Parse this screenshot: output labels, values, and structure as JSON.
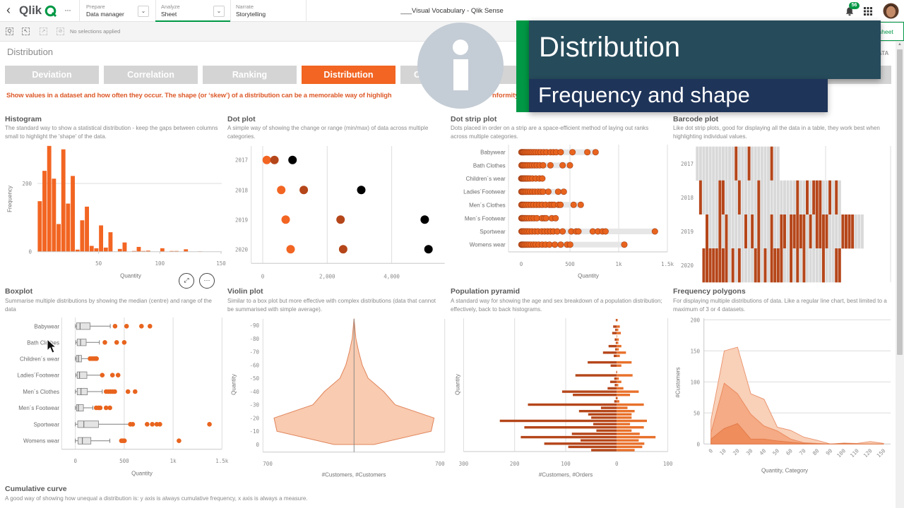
{
  "app": {
    "logo_text": "Qlik",
    "nav": [
      {
        "caption": "Prepare",
        "label": "Data manager"
      },
      {
        "caption": "Analyze",
        "label": "Sheet",
        "active": true
      },
      {
        "caption": "Narrate",
        "label": "Storytelling"
      }
    ],
    "more_glyph": "···",
    "back_glyph": "‹",
    "dropdown_glyph": "⌄",
    "title": "___Visual Vocabulary - Qlik Sense",
    "notifications_count": "56",
    "icons": [
      "chevron-left-icon",
      "qlik-logo-icon",
      "ellipsis-icon",
      "bell-icon",
      "app-grid-icon",
      "avatar"
    ]
  },
  "toolbar": {
    "selections_text": "No selections applied",
    "icons": [
      "smart-search-icon",
      "selections-tool-icon",
      "step-forward-icon",
      "clear-selections-icon"
    ]
  },
  "sheet": {
    "title": "Distribution",
    "tabs": [
      {
        "label": "Deviation"
      },
      {
        "label": "Correlation"
      },
      {
        "label": "Ranking"
      },
      {
        "label": "Distribution",
        "active": true
      },
      {
        "label": "C"
      }
    ],
    "intro_text": "Show values in a dataset and how often they occur. The shape (or ‘skew’) of a distribution can be a memorable way of highligh",
    "intro_tail": "nformity",
    "edit_button": "Edit sheet",
    "right_link_fragment": "ATA",
    "next_section": {
      "title": "Cumulative curve",
      "description": "A good way of showing how unequal a distribution is: y axis is always cumulative frequency, x axis is always a measure."
    },
    "chart_actions": {
      "expand_glyph": "⤢",
      "more_glyph": "···"
    }
  },
  "overlay": {
    "info_glyph": "i",
    "heading": "Distribution",
    "subheading": "Frequency and shape"
  },
  "theme": {
    "accent": "#f26522",
    "dark_orange": "#b5461a",
    "tab_inactive": "#d4d4d4",
    "qlik_green": "#009845",
    "overlay_teal": "#264b5b",
    "overlay_navy": "#1f3459"
  },
  "chart_data": [
    {
      "id": "histogram",
      "type": "bar",
      "title": "Histogram",
      "description": "The standard way to show a statistical distribution - keep the gaps between columns small to highlight the 'shape' of the data.",
      "xlabel": "Quantity",
      "ylabel": "Frequency",
      "xlim": [
        0,
        150
      ],
      "x_ticks": [
        50,
        100,
        150
      ],
      "y_ticks": [
        0,
        200
      ],
      "bin_width": 3.85,
      "values": [
        148,
        237,
        310,
        214,
        81,
        300,
        141,
        222,
        6,
        92,
        132,
        17,
        10,
        77,
        12,
        57,
        0,
        8,
        27,
        0,
        2,
        14,
        2,
        3,
        0,
        0,
        10,
        0,
        2,
        2,
        0,
        7,
        0,
        0,
        1,
        0,
        0,
        0,
        0
      ],
      "color": "#f26522",
      "grid": true
    },
    {
      "id": "dot-plot",
      "type": "scatter",
      "title": "Dot plot",
      "description": "A simple way of showing the change or range (min/max) of data across multiple categories.",
      "categories": [
        "2017",
        "2018",
        "2019",
        "2020"
      ],
      "series": [
        {
          "color": "#f26522",
          "values": [
            124,
            575,
            713,
            866
          ]
        },
        {
          "color": "#b5461a",
          "values": [
            364,
            1273,
            2415,
            2495
          ]
        },
        {
          "color": "#000000",
          "values": [
            924,
            3055,
            5025,
            5142
          ]
        }
      ],
      "x_ticks": [
        0,
        2000,
        4000
      ],
      "x_tick_labels": [
        "0",
        "2,000",
        "4,000"
      ],
      "xlim": [
        -350,
        5630
      ]
    },
    {
      "id": "dot-strip-plot",
      "type": "scatter",
      "title": "Dot strip plot",
      "description": "Dots placed in order on a strip are a space-efficient method of laying out ranks across multiple categories.",
      "xlabel": "Quantity",
      "categories": [
        "Babywear",
        "Bath Clothes",
        "Children´s wear",
        "Ladies´Footwear",
        "Men´s Clothes",
        "Men´s Footwear",
        "Sportwear",
        "Womens wear"
      ],
      "values": [
        [
          2,
          8,
          15,
          22,
          30,
          40,
          52,
          65,
          80,
          95,
          110,
          130,
          150,
          175,
          200,
          230,
          260,
          300,
          330,
          360,
          405,
          526,
          678,
          763
        ],
        [
          3,
          10,
          18,
          28,
          40,
          55,
          70,
          90,
          110,
          135,
          160,
          190,
          225,
          300,
          425,
          500
        ],
        [
          1,
          5,
          10,
          16,
          24,
          32,
          42,
          55,
          70,
          90,
          115,
          150,
          188,
          217
        ],
        [
          2,
          8,
          15,
          25,
          38,
          52,
          70,
          90,
          115,
          140,
          170,
          200,
          225,
          278,
          379,
          437
        ],
        [
          2,
          8,
          15,
          25,
          38,
          55,
          75,
          100,
          125,
          155,
          185,
          215,
          250,
          290,
          314,
          338,
          382,
          403,
          538,
          611
        ],
        [
          2,
          7,
          14,
          22,
          32,
          45,
          60,
          80,
          105,
          130,
          160,
          213,
          237,
          254,
          314,
          353
        ],
        [
          3,
          10,
          20,
          32,
          48,
          65,
          85,
          110,
          140,
          170,
          210,
          240,
          270,
          300,
          330,
          370,
          425,
          514,
          563,
          587,
          734,
          787,
          833,
          865,
          1372
        ],
        [
          2,
          8,
          15,
          24,
          35,
          48,
          62,
          80,
          100,
          125,
          150,
          180,
          215,
          250,
          290,
          345,
          405,
          471,
          502,
          1058
        ]
      ],
      "x_ticks": [
        0,
        500,
        1000,
        1500
      ],
      "x_tick_labels": [
        "0",
        "500",
        "1k",
        "1.5k"
      ],
      "color": "#e8641e"
    },
    {
      "id": "barcode-plot",
      "type": "heatmap",
      "subtype": "barcode",
      "title": "Barcode plot",
      "description": "Like dot strip plots, good for displaying all the data in a table, they work best when highlighting individual values.",
      "categories": [
        "2017",
        "2018",
        "2019",
        "2020"
      ],
      "rows": [
        {
          "extent": [
            0,
            26
          ],
          "marks": [
            12,
            16,
            23
          ]
        },
        {
          "extent": [
            1,
            45
          ],
          "marks": [
            1,
            7,
            8,
            13,
            19,
            31,
            34,
            36,
            37,
            38,
            41,
            43
          ]
        },
        {
          "extent": [
            3,
            52
          ],
          "marks": [
            3,
            7,
            9,
            15,
            17,
            19,
            23,
            26,
            27,
            29,
            30,
            31,
            32,
            33,
            35,
            37,
            38,
            39,
            40,
            45,
            46,
            47,
            48
          ]
        },
        {
          "extent": [
            2,
            45
          ],
          "marks": [
            2,
            3,
            4,
            5,
            6,
            7,
            8,
            9,
            11,
            13,
            18,
            19,
            21,
            23,
            24,
            25,
            26,
            29,
            31,
            33,
            39,
            43,
            44
          ]
        }
      ],
      "mark_color": "#b5461a",
      "base_color": "#d9d9d9"
    },
    {
      "id": "boxplot",
      "type": "bar",
      "subtype": "boxplot",
      "title": "Boxplot",
      "description": "Summarise multiple distributions by showing the median (centre) and range of the data",
      "xlabel": "Quantity",
      "x_ticks": [
        0,
        500,
        1000,
        1500
      ],
      "x_tick_labels": [
        "0",
        "500",
        "1k",
        "1.5k"
      ],
      "boxes": [
        {
          "category": "Babywear",
          "min": 0,
          "q1": 12,
          "median": 48,
          "q3": 150,
          "max": 357,
          "outliers": [
            406,
            524,
            676,
            763
          ]
        },
        {
          "category": "Bath Clothes",
          "min": 5,
          "q1": 19,
          "median": 53,
          "q3": 111,
          "max": 246,
          "outliers": [
            302,
            423,
            500
          ]
        },
        {
          "category": "Children´s wear",
          "min": 0,
          "q1": 10,
          "median": 31,
          "q3": 63,
          "max": 140,
          "outliers": [
            150,
            170,
            188,
            205,
            217
          ]
        },
        {
          "category": "Ladies´Footwear",
          "min": 5,
          "q1": 19,
          "median": 43,
          "q3": 118,
          "max": 275,
          "outliers": [
            275,
            379,
            437
          ]
        },
        {
          "category": "Men´s Clothes",
          "min": 0,
          "q1": 19,
          "median": 58,
          "q3": 123,
          "max": 275,
          "outliers": [
            314,
            338,
            360,
            382,
            403,
            538,
            611
          ]
        },
        {
          "category": "Men´s Footwear",
          "min": 0,
          "q1": 12,
          "median": 31,
          "q3": 82,
          "max": 179,
          "outliers": [
            213,
            237,
            254,
            314,
            353
          ]
        },
        {
          "category": "Sportwear",
          "min": 0,
          "q1": 24,
          "median": 87,
          "q3": 237,
          "max": 563,
          "outliers": [
            563,
            587,
            734,
            787,
            833,
            865,
            1372
          ]
        },
        {
          "category": "Womens wear",
          "min": 0,
          "q1": 27,
          "median": 72,
          "q3": 159,
          "max": 353,
          "outliers": [
            471,
            487,
            502,
            1060
          ]
        }
      ],
      "outlier_color": "#e8641e"
    },
    {
      "id": "violin-plot",
      "type": "area",
      "subtype": "violin",
      "title": "Violin plot",
      "description": "Similar to a box plot but more effective with complex distributions (data that cannot be summarised with simple average).",
      "ylabel": "Quantity",
      "xlabel": "#Customers, #Customers",
      "x_tick_labels": [
        "700",
        "700"
      ],
      "y_ticks": [
        -90,
        -80,
        -70,
        -60,
        -50,
        -40,
        -30,
        -20,
        -10,
        0
      ],
      "levels": [
        0,
        -10,
        -20,
        -30,
        -40,
        -50,
        -60,
        -70,
        -80,
        -90,
        -95
      ],
      "half_widths": [
        154,
        594,
        616,
        317,
        228,
        109,
        63,
        36,
        14,
        5,
        0
      ],
      "xlim": [
        -700,
        700
      ],
      "fill": "#f9cbb0",
      "stroke": "#e0845a"
    },
    {
      "id": "population-pyramid",
      "type": "bar",
      "subtype": "population-pyramid",
      "title": "Population pyramid",
      "description": "A standard way for showing the age and sex breakdown of a population distribution; effectively, back to back histograms.",
      "ylabel": "Quantity",
      "xlabel": "#Customers, #Orders",
      "x_ticks": [
        -300,
        -200,
        -100,
        0,
        100
      ],
      "x_tick_labels": [
        "300",
        "200",
        "100",
        "0",
        "100"
      ],
      "series": [
        {
          "name": "#Customers",
          "side": "left",
          "color": "#b5461a",
          "values": [
            2,
            0,
            7,
            3,
            9,
            0,
            4,
            2,
            16,
            3,
            27,
            6,
            0,
            57,
            12,
            0,
            1,
            81,
            5,
            13,
            4,
            18,
            107,
            86,
            2,
            5,
            174,
            31,
            74,
            56,
            50,
            229,
            46,
            181,
            40,
            88,
            188,
            71,
            142,
            95,
            50
          ]
        },
        {
          "name": "#Orders",
          "side": "right",
          "color": "#e8702a",
          "values": [
            2,
            0,
            6,
            3,
            8,
            1,
            4,
            3,
            9,
            4,
            18,
            6,
            0,
            29,
            9,
            0,
            1,
            31,
            4,
            9,
            3,
            13,
            43,
            26,
            2,
            5,
            53,
            21,
            35,
            29,
            29,
            59,
            26,
            53,
            29,
            45,
            76,
            43,
            54,
            50,
            35
          ]
        }
      ]
    },
    {
      "id": "frequency-polygons",
      "type": "area",
      "title": "Frequency polygons",
      "description": "For displaying multiple distributions of data. Like a regular line chart, best limited to a maximum of 3 or 4 datasets.",
      "ylabel": "#Customers",
      "xlabel": "Quantity, Category",
      "categories": [
        "0",
        "10",
        "20",
        "30",
        "40",
        "50",
        "60",
        "70",
        "80",
        "90",
        "100",
        "110",
        "120",
        "150"
      ],
      "y_ticks": [
        0,
        50,
        100,
        150,
        200
      ],
      "ylim": [
        0,
        200
      ],
      "series": [
        {
          "fill": "#f9d0b8",
          "stroke": "#e9906a",
          "values": [
            39,
            150,
            156,
            81,
            72,
            27,
            22,
            11,
            6,
            0,
            1.5,
            1,
            4,
            1
          ]
        },
        {
          "fill": "#f5ab85",
          "stroke": "#e9865a",
          "values": [
            18,
            98,
            81,
            48,
            29,
            21,
            8,
            2,
            1,
            0,
            0,
            0,
            0,
            0
          ]
        },
        {
          "fill": "#f08d5c",
          "stroke": "#e07a48",
          "values": [
            8,
            25,
            33,
            8,
            8,
            5,
            3,
            1,
            0,
            0,
            1,
            0,
            0,
            0
          ]
        }
      ]
    }
  ]
}
